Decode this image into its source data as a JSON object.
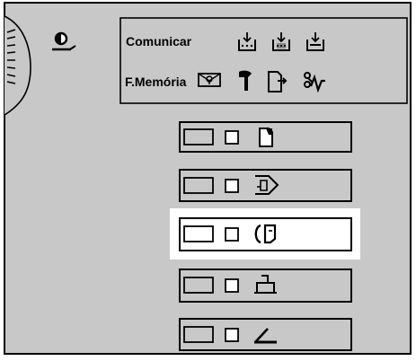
{
  "panel": {
    "labels": {
      "communication": "Comunicar",
      "memory": "F.Memória"
    },
    "indicator_icons": [
      "communication-tray-icon",
      "communication-busy-icon",
      "communication-receive-icon",
      "confidential-mailbox-icon",
      "service-wrench-icon",
      "paper-misfeed-icon",
      "cover-open-icon"
    ],
    "function_keys": [
      {
        "name": "copy-key",
        "icon": "copy-page-icon",
        "highlighted": false
      },
      {
        "name": "document-server-key",
        "icon": "document-server-icon",
        "highlighted": false
      },
      {
        "name": "facsimile-key",
        "icon": "facsimile-icon",
        "highlighted": true
      },
      {
        "name": "printer-key",
        "icon": "printer-icon",
        "highlighted": false
      },
      {
        "name": "scanner-key",
        "icon": "scanner-icon",
        "highlighted": false
      }
    ],
    "colors": {
      "panel_gray": "#c8c8c8",
      "highlight": "#ffffff",
      "line": "#000000"
    }
  }
}
